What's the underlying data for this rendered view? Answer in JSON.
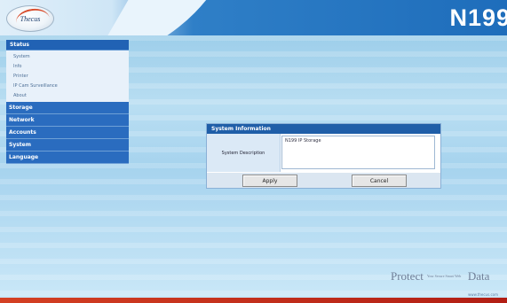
{
  "header": {
    "logo_text": "Thecus",
    "model": "N199"
  },
  "sidebar": {
    "active_menu": "Status",
    "submenu": [
      "System",
      "Info",
      "Printer",
      "IP Cam Surveillance",
      "About"
    ],
    "menus": [
      "Storage",
      "Network",
      "Accounts",
      "System",
      "Language"
    ]
  },
  "dialog": {
    "title": "System Information",
    "label": "System Description",
    "value": "N199 IP Storage",
    "apply": "Apply",
    "cancel": "Cancel"
  },
  "footer": {
    "tag_left": "Protect",
    "tag_small": "Your Secure Smart Web",
    "tag_right": "Data",
    "url": "www.thecus.com"
  },
  "colors": {
    "menu_blue": "#2a6cbf",
    "title_blue": "#1f5ea8",
    "bottom_red": "#b21e14"
  }
}
